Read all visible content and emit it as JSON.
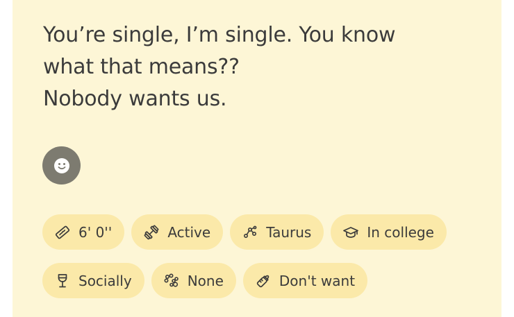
{
  "prompt": {
    "text": "You’re single, I’m single. You know\nwhat that means??\nNobody wants us."
  },
  "reaction": {
    "icon": "smiley-face-icon",
    "color": "#7d7b70"
  },
  "chips_row1": [
    {
      "icon": "ruler-icon",
      "label": "6' 0''"
    },
    {
      "icon": "dumbbell-icon",
      "label": "Active"
    },
    {
      "icon": "zodiac-icon",
      "label": "Taurus"
    },
    {
      "icon": "graduation-cap-icon",
      "label": "In college"
    }
  ],
  "chips_row2": [
    {
      "icon": "wine-glass-icon",
      "label": "Socially"
    },
    {
      "icon": "paw-icon",
      "label": "None"
    },
    {
      "icon": "baby-bottle-icon",
      "label": "Don't want"
    }
  ],
  "colors": {
    "card_background": "#fdf6d6",
    "chip_background": "#fbe9a9",
    "text": "#3b3b3b"
  }
}
